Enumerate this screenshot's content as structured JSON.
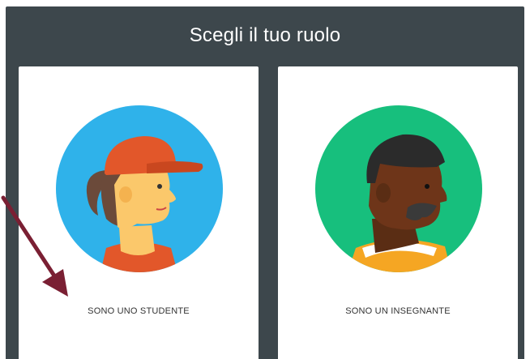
{
  "dialog": {
    "title": "Scegli il tuo ruolo"
  },
  "roles": {
    "student": {
      "label": "SONO UNO STUDENTE",
      "avatar_bg": "#2fb2ea"
    },
    "teacher": {
      "label": "SONO UN INSEGNANTE",
      "avatar_bg": "#17bf7d"
    }
  },
  "colors": {
    "header_bg": "#3d474c",
    "card_bg": "#ffffff",
    "annotation_arrow": "#7a1f33"
  },
  "icons": {
    "student_avatar": "student-avatar-icon",
    "teacher_avatar": "teacher-avatar-icon",
    "annotation": "arrow-icon"
  }
}
